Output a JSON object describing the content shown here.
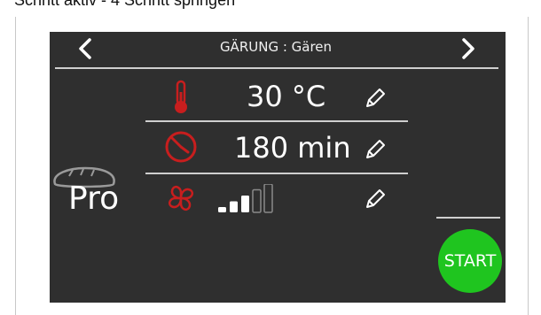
{
  "window": {
    "top_text": "Schritt aktiv - 4 Schritt springen"
  },
  "header": {
    "title": "GÄRUNG : Gären",
    "prev_icon": "chevron-left-icon",
    "next_icon": "chevron-right-icon"
  },
  "program": {
    "label": "Pro",
    "icon": "bread-icon"
  },
  "rows": {
    "temperature": {
      "value": "30 °C",
      "icon": "thermometer-icon"
    },
    "time": {
      "value": "180 min",
      "icon": "timer-icon"
    },
    "fan": {
      "level": 3,
      "max_level": 5,
      "icon": "fan-icon"
    }
  },
  "actions": {
    "start_label": "START"
  },
  "colors": {
    "accent_red": "#c81e1e",
    "start_green": "#1fc51f",
    "screen_bg": "#2f2f2f"
  }
}
